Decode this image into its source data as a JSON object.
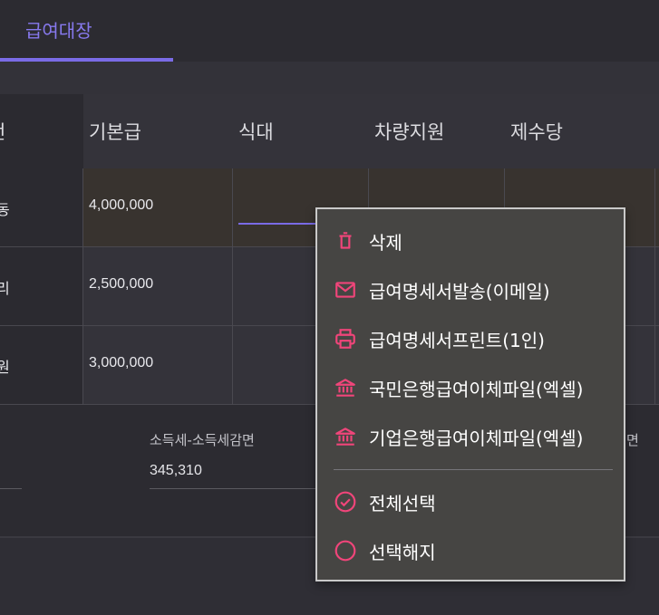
{
  "tab": {
    "label": "급여대장"
  },
  "table": {
    "headers": [
      "기본급",
      "식대",
      "차량지원",
      "제수당"
    ],
    "name_header": "번",
    "rows": [
      {
        "name": "동",
        "base_pay": "4,000,000"
      },
      {
        "name": "리",
        "base_pay": "2,500,000"
      },
      {
        "name": "원",
        "base_pay": "3,000,000"
      }
    ]
  },
  "footer": {
    "income_tax": {
      "label": "소득세-소득세감면",
      "value": "345,310"
    },
    "cut_label": "면"
  },
  "context_menu": {
    "items": [
      {
        "label": "삭제",
        "icon": "trash-icon"
      },
      {
        "label": "급여명세서발송(이메일)",
        "icon": "mail-icon"
      },
      {
        "label": "급여명세서프린트(1인)",
        "icon": "printer-icon"
      },
      {
        "label": "국민은행급여이체파일(엑셀)",
        "icon": "bank-icon"
      },
      {
        "label": "기업은행급여이체파일(엑셀)",
        "icon": "bank-icon"
      },
      {
        "label": "전체선택",
        "icon": "check-circle-icon"
      },
      {
        "label": "선택해지",
        "icon": "circle-icon"
      }
    ]
  },
  "colors": {
    "accent": "#7a6be6",
    "icon": "#f0457a",
    "background": "#2f2e35",
    "menu_background": "#464543"
  }
}
